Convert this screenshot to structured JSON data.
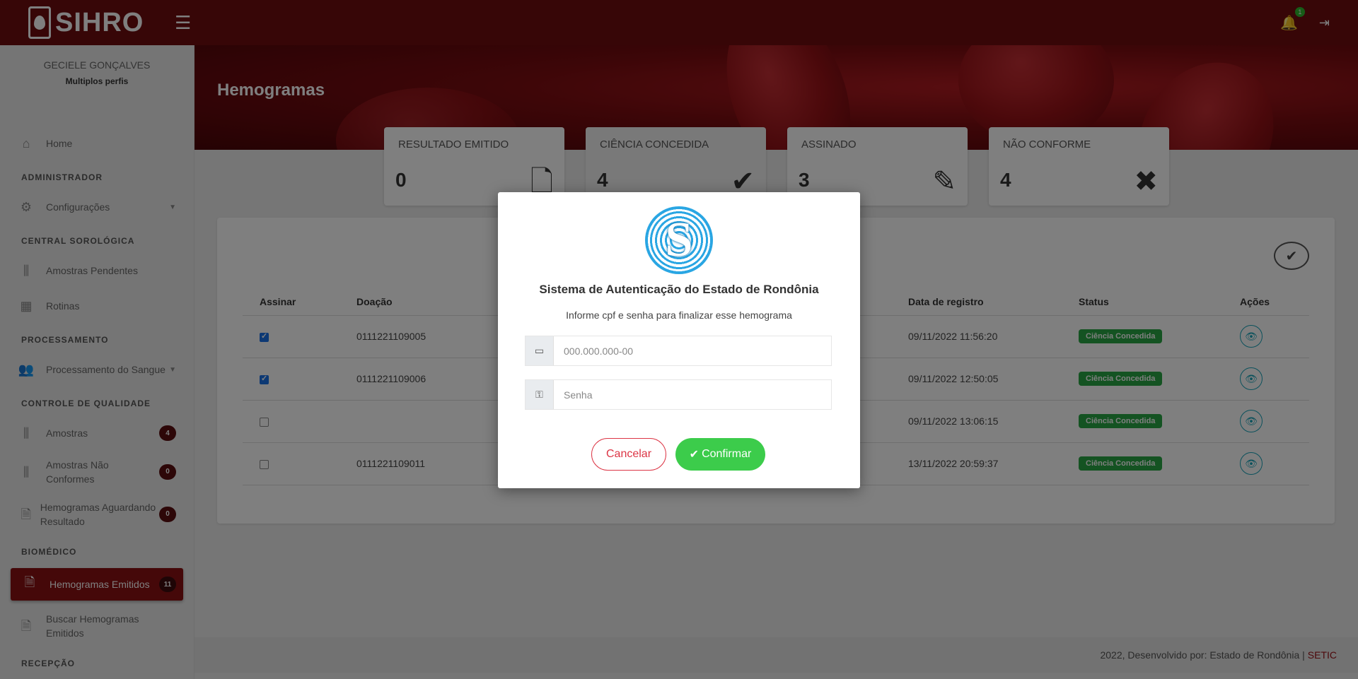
{
  "topbar": {
    "brand": "SIHRO",
    "hamburger": "☰",
    "notifications_count": "1",
    "bell_icon": "🔔",
    "logout_icon": "⇥"
  },
  "user": {
    "name": "GECIELE GONÇALVES",
    "profile": "Multiplos perfis"
  },
  "sidebar": {
    "home": "Home",
    "section_admin": "ADMINISTRADOR",
    "config": "Configurações",
    "section_central": "CENTRAL SOROLÓGICA",
    "amostras_pendentes": "Amostras Pendentes",
    "rotinas": "Rotinas",
    "section_processamento": "PROCESSAMENTO",
    "processamento_sangue": "Processamento do Sangue",
    "section_controle": "CONTROLE DE QUALIDADE",
    "amostras": "Amostras",
    "amostras_count": "4",
    "amostras_nao_conformes": "Amostras Não Conformes",
    "amostras_nao_conformes_count": "0",
    "hemogramas_aguardando": "Hemogramas Aguardando Resultado",
    "hemogramas_aguardando_count": "0",
    "section_biomedico": "BIOMÉDICO",
    "hemogramas_emitidos": "Hemogramas Emitidos",
    "hemogramas_emitidos_count": "11",
    "buscar_hemogramas": "Buscar Hemogramas Emitidos",
    "section_recepcao": "RECEPÇÃO"
  },
  "page": {
    "title": "Hemogramas"
  },
  "stats": [
    {
      "label": "RESULTADO EMITIDO",
      "value": "0",
      "icon": "🗋"
    },
    {
      "label": "CIÊNCIA CONCEDIDA",
      "value": "4",
      "icon": "✔"
    },
    {
      "label": "ASSINADO",
      "value": "3",
      "icon": "✎"
    },
    {
      "label": "NÃO CONFORME",
      "value": "4",
      "icon": "✖"
    }
  ],
  "table": {
    "headers": {
      "assinar": "Assinar",
      "doacao": "Doação",
      "data_registro": "Data de registro",
      "status": "Status",
      "acoes": "Ações"
    },
    "rows": [
      {
        "checked": true,
        "doacao": "0111221109005",
        "data": "09/11/2022 11:56:20",
        "status": "Ciência Concedida"
      },
      {
        "checked": true,
        "doacao": "0111221109006",
        "data": "09/11/2022 12:50:05",
        "status": "Ciência Concedida"
      },
      {
        "checked": false,
        "doacao": "",
        "data": "09/11/2022 13:06:15",
        "status": "Ciência Concedida"
      },
      {
        "checked": false,
        "doacao": "0111221109011",
        "data": "13/11/2022 20:59:37",
        "status": "Ciência Concedida"
      }
    ]
  },
  "footer": {
    "text": "2022, Desenvolvido por: Estado de Rondônia |",
    "link": "SETIC"
  },
  "modal": {
    "logo_letter": "S",
    "title": "Sistema de Autenticação do Estado de Rondônia",
    "subtitle": "Informe cpf e senha para finalizar esse hemograma",
    "cpf_placeholder": "000.000.000-00",
    "password_placeholder": "Senha",
    "cancel_label": "Cancelar",
    "confirm_label": "Confirmar"
  },
  "colors": {
    "brand": "#6e0c0f",
    "active": "#8b1013",
    "success": "#3ccc4b",
    "danger": "#dc3545"
  }
}
